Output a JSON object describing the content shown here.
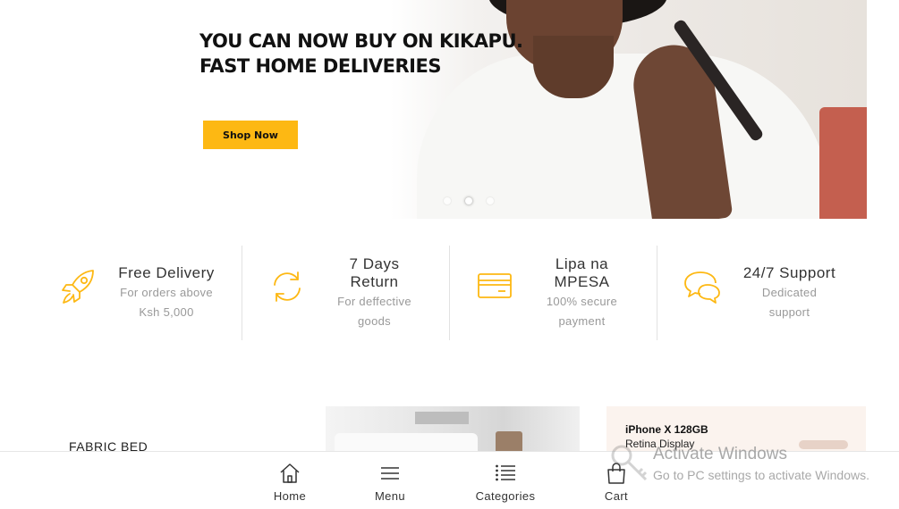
{
  "hero": {
    "headline_line1": "YOU CAN NOW BUY ON KIKAPU.",
    "headline_line2": "FAST HOME DELIVERIES",
    "cta_label": "Shop Now",
    "cta_color": "#fdb813",
    "slide_count": 3,
    "active_slide": 2
  },
  "features": [
    {
      "icon": "rocket-icon",
      "title": "Free Delivery",
      "subtitle_line1": "For orders above",
      "subtitle_line2": "Ksh 5,000"
    },
    {
      "icon": "refresh-icon",
      "title_line1": "7 Days",
      "title_line2": "Return",
      "subtitle_line1": "For deffective",
      "subtitle_line2": "goods"
    },
    {
      "icon": "credit-card-icon",
      "title_line1": "Lipa na",
      "title_line2": "MPESA",
      "subtitle_line1": "100% secure",
      "subtitle_line2": "payment"
    },
    {
      "icon": "chat-bubbles-icon",
      "title": "24/7 Support",
      "subtitle_line1": "Dedicated",
      "subtitle_line2": "support"
    }
  ],
  "feature_icon_color": "#fdb813",
  "promos": {
    "left_label": "FABRIC BED",
    "right_title": "iPhone X 128GB",
    "right_subtitle": "Retina Display"
  },
  "bottom_nav": {
    "home": "Home",
    "menu": "Menu",
    "categories": "Categories",
    "cart": "Cart"
  },
  "watermark": {
    "title": "Activate Windows",
    "subtitle": "Go to PC settings to activate Windows."
  }
}
